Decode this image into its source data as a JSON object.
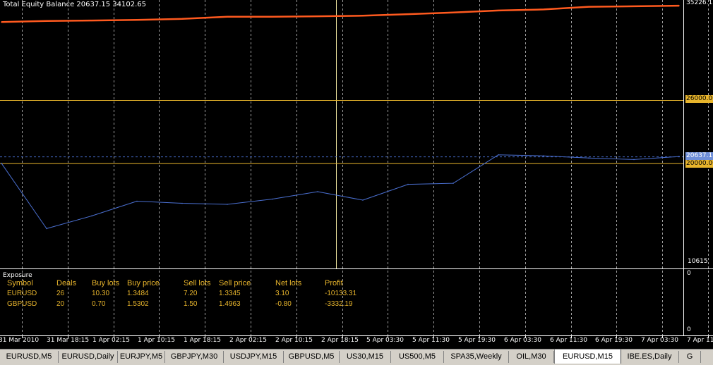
{
  "indicator": {
    "name": "Total Equity Balance",
    "values": "20637.15 34102.65"
  },
  "price_scale": {
    "top": "35226.13",
    "level_upper": "26000.00",
    "current": "20637.15",
    "level_lower": "20000.00",
    "bottom": "10615"
  },
  "exposure": {
    "title": "Exposure",
    "scale_top": "0",
    "scale_bottom": "0",
    "headers": [
      "Symbol",
      "Deals",
      "Buy lots",
      "Buy price",
      "Sell lots",
      "Sell price",
      "Net lots",
      "Profit"
    ],
    "rows": [
      [
        "EURUSD",
        "26",
        "10.30",
        "1.3484",
        "7.20",
        "1.3345",
        "3.10",
        "-10133.31"
      ],
      [
        "GBPUSD",
        "20",
        "0.70",
        "1.5302",
        "1.50",
        "1.4963",
        "-0.80",
        "-3332.19"
      ]
    ]
  },
  "time_axis": [
    "31 Mar 2010",
    "31 Mar 18:15",
    "1 Apr 02:15",
    "1 Apr 10:15",
    "1 Apr 18:15",
    "2 Apr 02:15",
    "2 Apr 10:15",
    "2 Apr 18:15",
    "5 Apr 03:30",
    "5 Apr 11:30",
    "5 Apr 19:30",
    "6 Apr 03:30",
    "6 Apr 11:30",
    "6 Apr 19:30",
    "7 Apr 03:30",
    "7 Apr 11:30"
  ],
  "tabs": [
    "EURUSD,M5",
    "EURUSD,Daily",
    "EURJPY,M5",
    "GBPJPY,M30",
    "USDJPY,M15",
    "GBPUSD,M5",
    "US30,M15",
    "US500,M5",
    "SPA35,Weekly",
    "OIL,M30",
    "EURUSD,M15",
    "IBE.ES,Daily",
    "G"
  ],
  "active_tab": "EURUSD,M15",
  "colors": {
    "background": "#000000",
    "equity_line": "#ff5a1f",
    "balance_line": "#4a6fd0",
    "level_line": "#e8b52c",
    "grid": "#c8c8c8",
    "text": "#ffffff",
    "table_text": "#e8b52c"
  },
  "chart_data": {
    "type": "line",
    "ylim": [
      10615,
      35226.13
    ],
    "hlines": [
      26000,
      20637.15,
      20000
    ],
    "x": [
      "31 Mar 2010",
      "31 Mar 18:15",
      "1 Apr 02:15",
      "1 Apr 10:15",
      "1 Apr 18:15",
      "2 Apr 02:15",
      "2 Apr 10:15",
      "2 Apr 18:15",
      "5 Apr 03:30",
      "5 Apr 11:30",
      "5 Apr 19:30",
      "6 Apr 03:30",
      "6 Apr 11:30",
      "6 Apr 19:30",
      "7 Apr 03:30",
      "7 Apr 11:30"
    ],
    "series": [
      {
        "values": [
          33400,
          33500,
          33550,
          33600,
          33700,
          33900,
          33900,
          33950,
          34000,
          34150,
          34300,
          34500,
          34600,
          34850,
          34900,
          34950
        ]
      },
      {
        "values": [
          20000,
          13800,
          15000,
          16400,
          16200,
          16100,
          16600,
          17300,
          16500,
          18000,
          18100,
          20800,
          20700,
          20500,
          20350,
          20637.15
        ]
      }
    ]
  }
}
